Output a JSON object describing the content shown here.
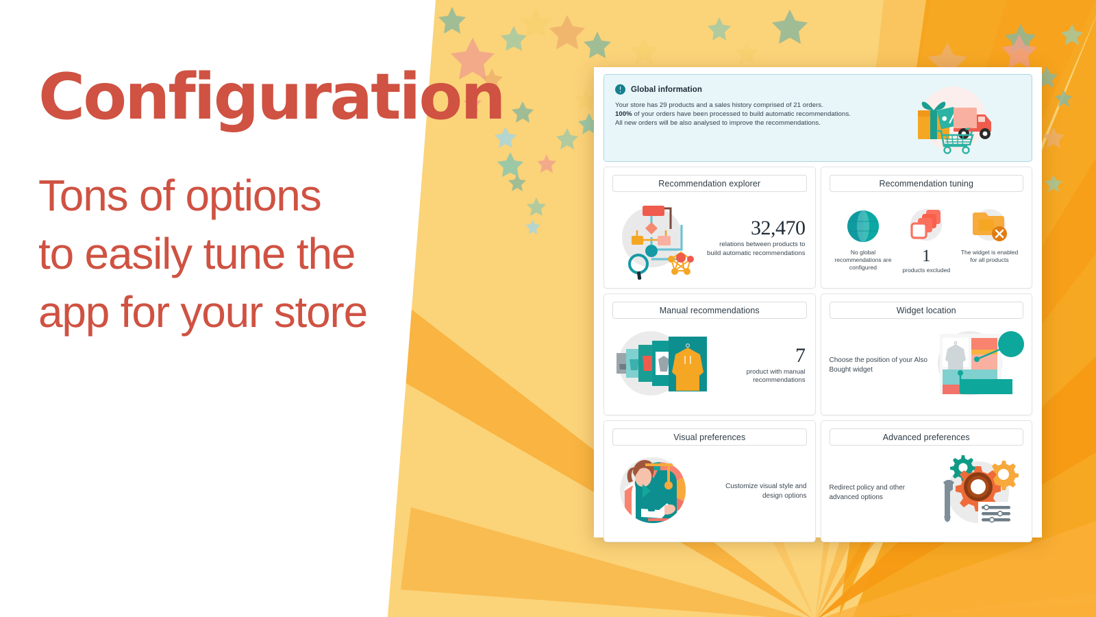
{
  "promo": {
    "title": "Configuration",
    "subtitle_lines": [
      "Tons of options",
      "to easily tune the",
      "app for your store"
    ],
    "accent_color": "#cf5242"
  },
  "colors": {
    "banner_bg": "#e8f6f9",
    "banner_border": "#a9d7e2",
    "teal": "#14818f",
    "orange": "#f5a623",
    "coral": "#f4705e"
  },
  "info_banner": {
    "icon": "exclamation-circle-icon",
    "title": "Global information",
    "lines": [
      "Your store has 29 products and a sales history comprised of 21 orders.",
      "100% of your orders have been processed to build automatic recommendations.",
      "All new orders will be also analysed to improve the recommendations."
    ],
    "line2_bold_prefix": "100%",
    "line2_rest": " of your orders have been processed to build automatic recommendations.",
    "illustration": "gift-truck-cart-icon"
  },
  "cards": [
    {
      "id": "recommendation-explorer",
      "title": "Recommendation explorer",
      "art": "network-diagram-icon",
      "art_side": "left",
      "stat_number": "32,470",
      "stat_caption": "relations between products to build automatic recommendations"
    },
    {
      "id": "recommendation-tuning",
      "title": "Recommendation tuning",
      "art": "tuning-triple-icon",
      "tuning": [
        {
          "icon": "globe-icon",
          "number": "",
          "label": "No global recommendations are configured"
        },
        {
          "icon": "stacked-squares-icon",
          "number": "1",
          "label": "products excluded"
        },
        {
          "icon": "folder-x-icon",
          "number": "",
          "label": "The widget is enabled for all products"
        }
      ]
    },
    {
      "id": "manual-recommendations",
      "title": "Manual recommendations",
      "art": "product-cards-stack-icon",
      "art_side": "left",
      "stat_number": "7",
      "stat_caption": "product with manual recommendations"
    },
    {
      "id": "widget-location",
      "title": "Widget location",
      "art": "page-layout-icon",
      "art_side": "right",
      "description": "Choose the position of your Also Bought widget"
    },
    {
      "id": "visual-preferences",
      "title": "Visual preferences",
      "art": "designer-palette-icon",
      "art_side": "left",
      "description": "Customize visual style and design options"
    },
    {
      "id": "advanced-preferences",
      "title": "Advanced preferences",
      "art": "gears-wrench-sliders-icon",
      "art_side": "right",
      "description": "Redirect policy and other advanced options"
    }
  ]
}
